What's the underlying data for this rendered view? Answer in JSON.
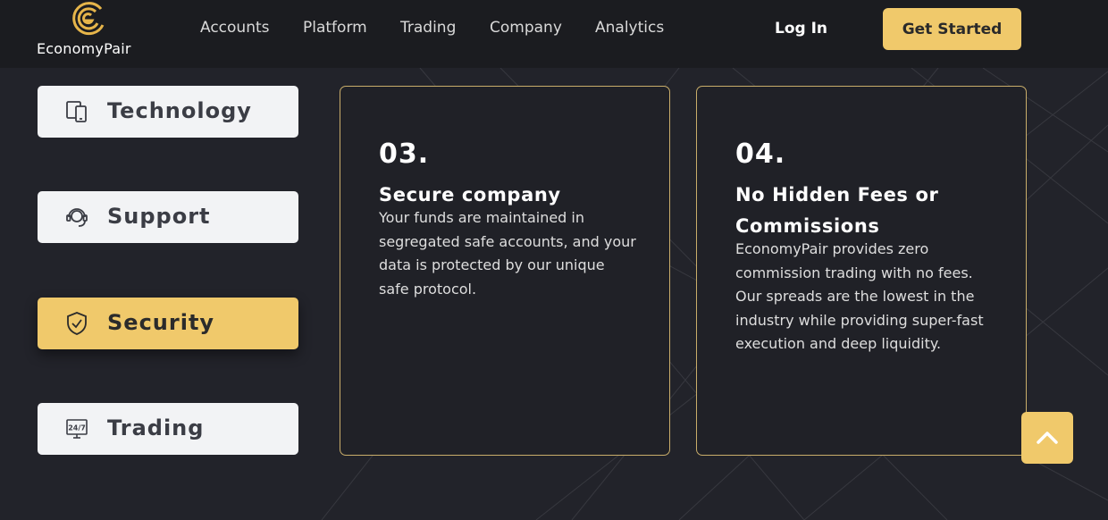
{
  "brand": {
    "name": "EconomyPair",
    "accent": "#f0c96b"
  },
  "nav": {
    "items": [
      "Accounts",
      "Platform",
      "Trading",
      "Company",
      "Analytics"
    ]
  },
  "header": {
    "login_label": "Log In",
    "cta_label": "Get Started"
  },
  "tabs": [
    {
      "label": "Technology",
      "icon": "devices-icon",
      "active": false
    },
    {
      "label": "Support",
      "icon": "support-agent-icon",
      "active": false
    },
    {
      "label": "Security",
      "icon": "shield-check-icon",
      "active": true
    },
    {
      "label": "Trading",
      "icon": "24-7-monitor-icon",
      "active": false
    }
  ],
  "cards": [
    {
      "number": "03.",
      "title": "Secure company",
      "text": "Your funds are maintained in segregated safe accounts, and your data is protected by our unique safe protocol."
    },
    {
      "number": "04.",
      "title": "No Hidden Fees or Commissions",
      "text": "EconomyPair provides zero commission trading with no fees. Our spreads are the lowest in the industry while providing super-fast execution and deep liquidity."
    }
  ],
  "scroll_top": {
    "icon": "chevron-up-icon"
  }
}
